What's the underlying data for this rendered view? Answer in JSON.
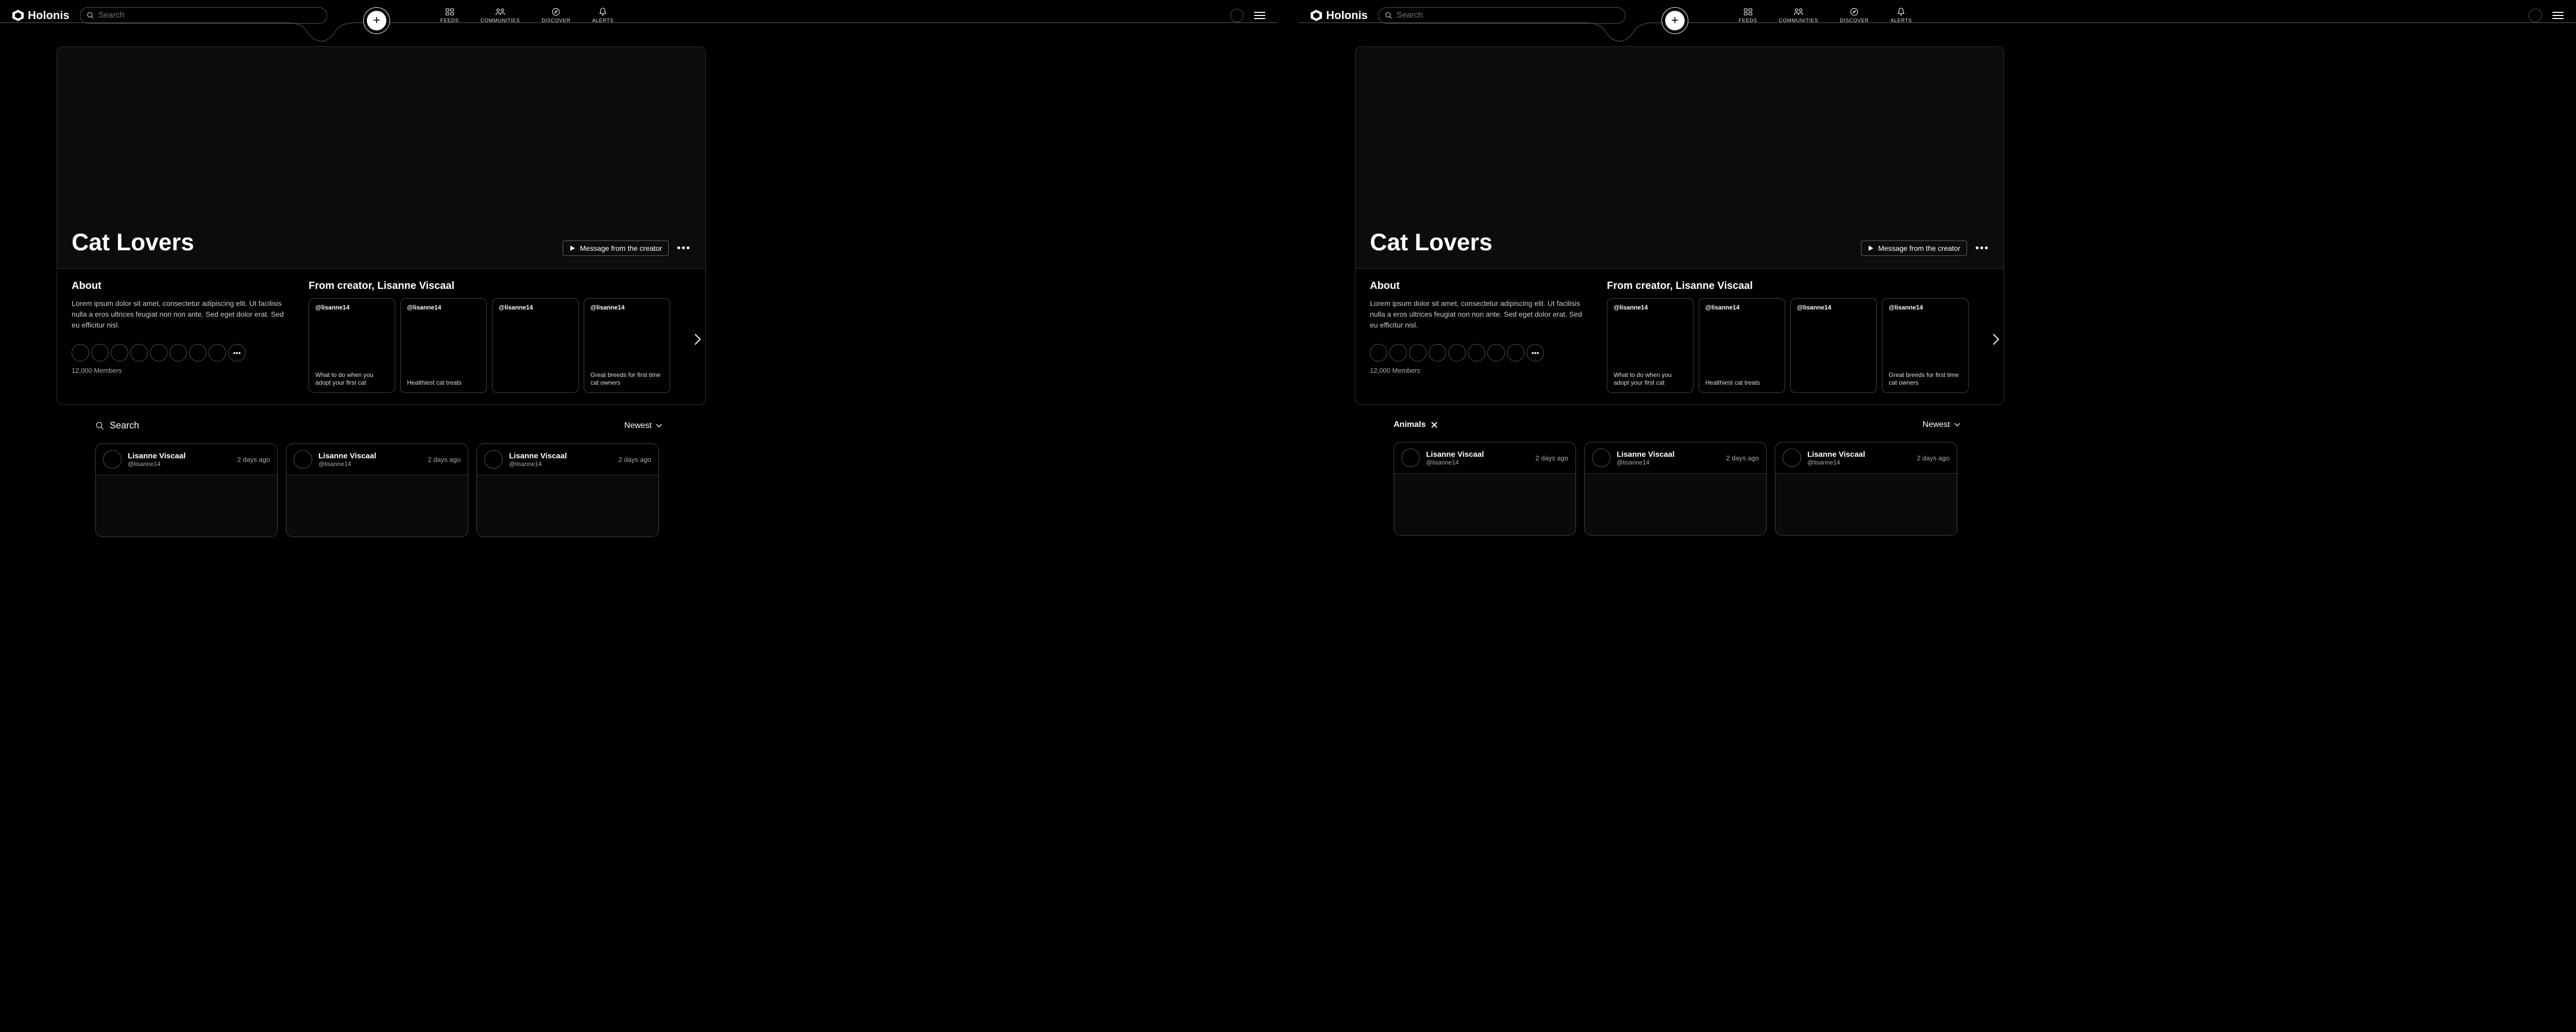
{
  "brand": "Holonis",
  "search": {
    "placeholder": "Search"
  },
  "nav": {
    "feeds": "FEEDS",
    "communities": "COMMUNITIES",
    "discover": "DISCOVER",
    "alerts": "ALERTS"
  },
  "community": {
    "title": "Cat Lovers",
    "message_btn": "Message from the creator",
    "about_heading": "About",
    "about_text": "Lorem ipsum dolor sit amet, consectetur adipiscing elit. Ut facilisis nulla a eros ultrices feugiat non non ante. Sed eget dolor erat. Sed eu efficitur nisl.",
    "members": "12,000 Members",
    "creator_heading": "From creator, Lisanne Viscaal",
    "cards": [
      {
        "handle": "@lisanne14",
        "caption": "What to do when you adopt your first cat"
      },
      {
        "handle": "@lisanne14",
        "caption": "Healthiest cat treats"
      },
      {
        "handle": "@lisanne14",
        "caption": ""
      },
      {
        "handle": "@lisanne14",
        "caption": "Great breeds for first time cat owners"
      }
    ]
  },
  "feed": {
    "search_label": "Search",
    "filter_tag": "Animals",
    "sort_label": "Newest",
    "posts": [
      {
        "author": "Lisanne Viscaal",
        "handle": "@lisanne14",
        "time": "2 days ago"
      },
      {
        "author": "Lisanne Viscaal",
        "handle": "@lisanne14",
        "time": "2 days ago"
      },
      {
        "author": "Lisanne Viscaal",
        "handle": "@lisanne14",
        "time": "2 days ago"
      }
    ]
  }
}
